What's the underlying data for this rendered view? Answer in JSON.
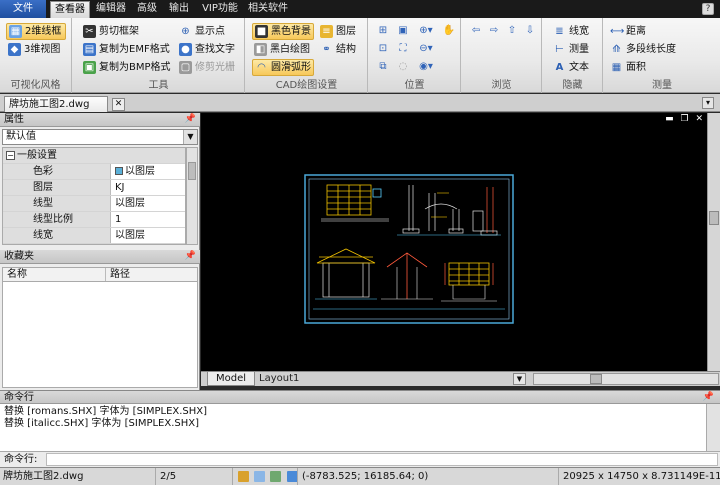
{
  "menubar": {
    "file": "文件",
    "items": [
      "查看器",
      "编辑器",
      "高级",
      "输出",
      "VIP功能",
      "相关软件"
    ],
    "help_glyph": "?"
  },
  "ribbon": {
    "visual_style": {
      "label": "可视化风格",
      "buttons": [
        "2维线框",
        "3维视图"
      ]
    },
    "tools": {
      "label": "工具",
      "buttons": [
        "剪切框架",
        "复制为EMF格式",
        "复制为BMP格式",
        "显示点",
        "查找文字",
        "修剪光栅"
      ]
    },
    "cad_settings": {
      "label": "CAD绘图设置",
      "buttons": [
        "黑色背景",
        "黑白绘图",
        "圆滑弧形",
        "图层",
        "结构"
      ]
    },
    "position": {
      "label": "位置"
    },
    "browse": {
      "label": "浏览"
    },
    "hide": {
      "label": "隐藏",
      "buttons": [
        "线宽",
        "测量",
        "文本"
      ]
    },
    "measure": {
      "label": "测量",
      "buttons": [
        "距离",
        "多段线长度",
        "面积"
      ]
    }
  },
  "document": {
    "tab_title": "牌坊施工图2.dwg",
    "close_glyph": "✕"
  },
  "properties": {
    "title": "属性",
    "selector_value": "默认值",
    "category": "一般设置",
    "rows": [
      {
        "key": "色彩",
        "value": "以图层"
      },
      {
        "key": "图层",
        "value": "KJ"
      },
      {
        "key": "线型",
        "value": "以图层"
      },
      {
        "key": "线型比例",
        "value": "1"
      },
      {
        "key": "线宽",
        "value": "以图层"
      }
    ]
  },
  "favorites": {
    "title": "收藏夹",
    "col_name": "名称",
    "col_path": "路径"
  },
  "layout_tabs": [
    "Model",
    "Layout1"
  ],
  "command": {
    "title": "命令行",
    "lines": [
      "替换 [romans.SHX] 字体为 [SIMPLEX.SHX]",
      "替换 [italicc.SHX] 字体为 [SIMPLEX.SHX]"
    ],
    "prompt": "命令行:"
  },
  "status": {
    "file": "牌坊施工图2.dwg",
    "page": "2/5",
    "coords": "(-8783.525; 16185.64; 0)",
    "size": "20925 x 14750 x 8.731149E-11"
  },
  "colors": {
    "canvas_bg": "#000000",
    "drawing_frame": "#4aa8d8",
    "active_button": "#f7c85a"
  }
}
